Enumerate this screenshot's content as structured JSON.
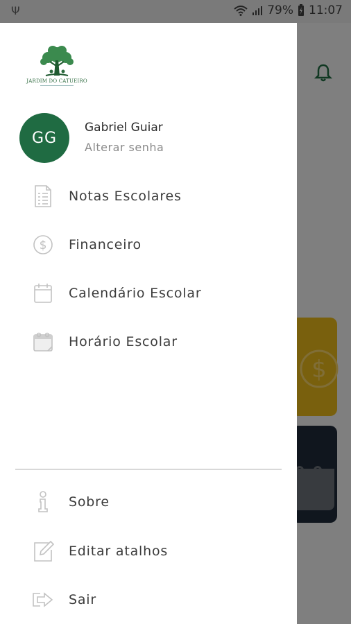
{
  "status_bar": {
    "battery_percent": "79%",
    "time": "11:07",
    "usb_icon": "usb-icon",
    "wifi_icon": "wifi-icon",
    "signal_icon": "signal-icon",
    "battery_icon": "battery-charging-icon"
  },
  "logo": {
    "text": "JARDIM DO CATUEIRO"
  },
  "user": {
    "initials": "GG",
    "name": "Gabriel Guiar",
    "change_password_label": "Alterar senha",
    "avatar_color": "#1f6b42"
  },
  "menu": {
    "items": [
      {
        "label": "Notas Escolares",
        "icon": "report-card-icon"
      },
      {
        "label": "Financeiro",
        "icon": "dollar-circle-icon"
      },
      {
        "label": "Calendário Escolar",
        "icon": "calendar-icon"
      },
      {
        "label": "Horário Escolar",
        "icon": "schedule-icon"
      }
    ],
    "footer_items": [
      {
        "label": "Sobre",
        "icon": "info-icon"
      },
      {
        "label": "Editar atalhos",
        "icon": "edit-icon"
      },
      {
        "label": "Sair",
        "icon": "logout-icon"
      }
    ]
  },
  "background_app": {
    "bell_icon": "bell-icon",
    "accent_color": "#1f6b42",
    "card_colors": [
      "#e8b91a",
      "#1f2b3a"
    ]
  }
}
